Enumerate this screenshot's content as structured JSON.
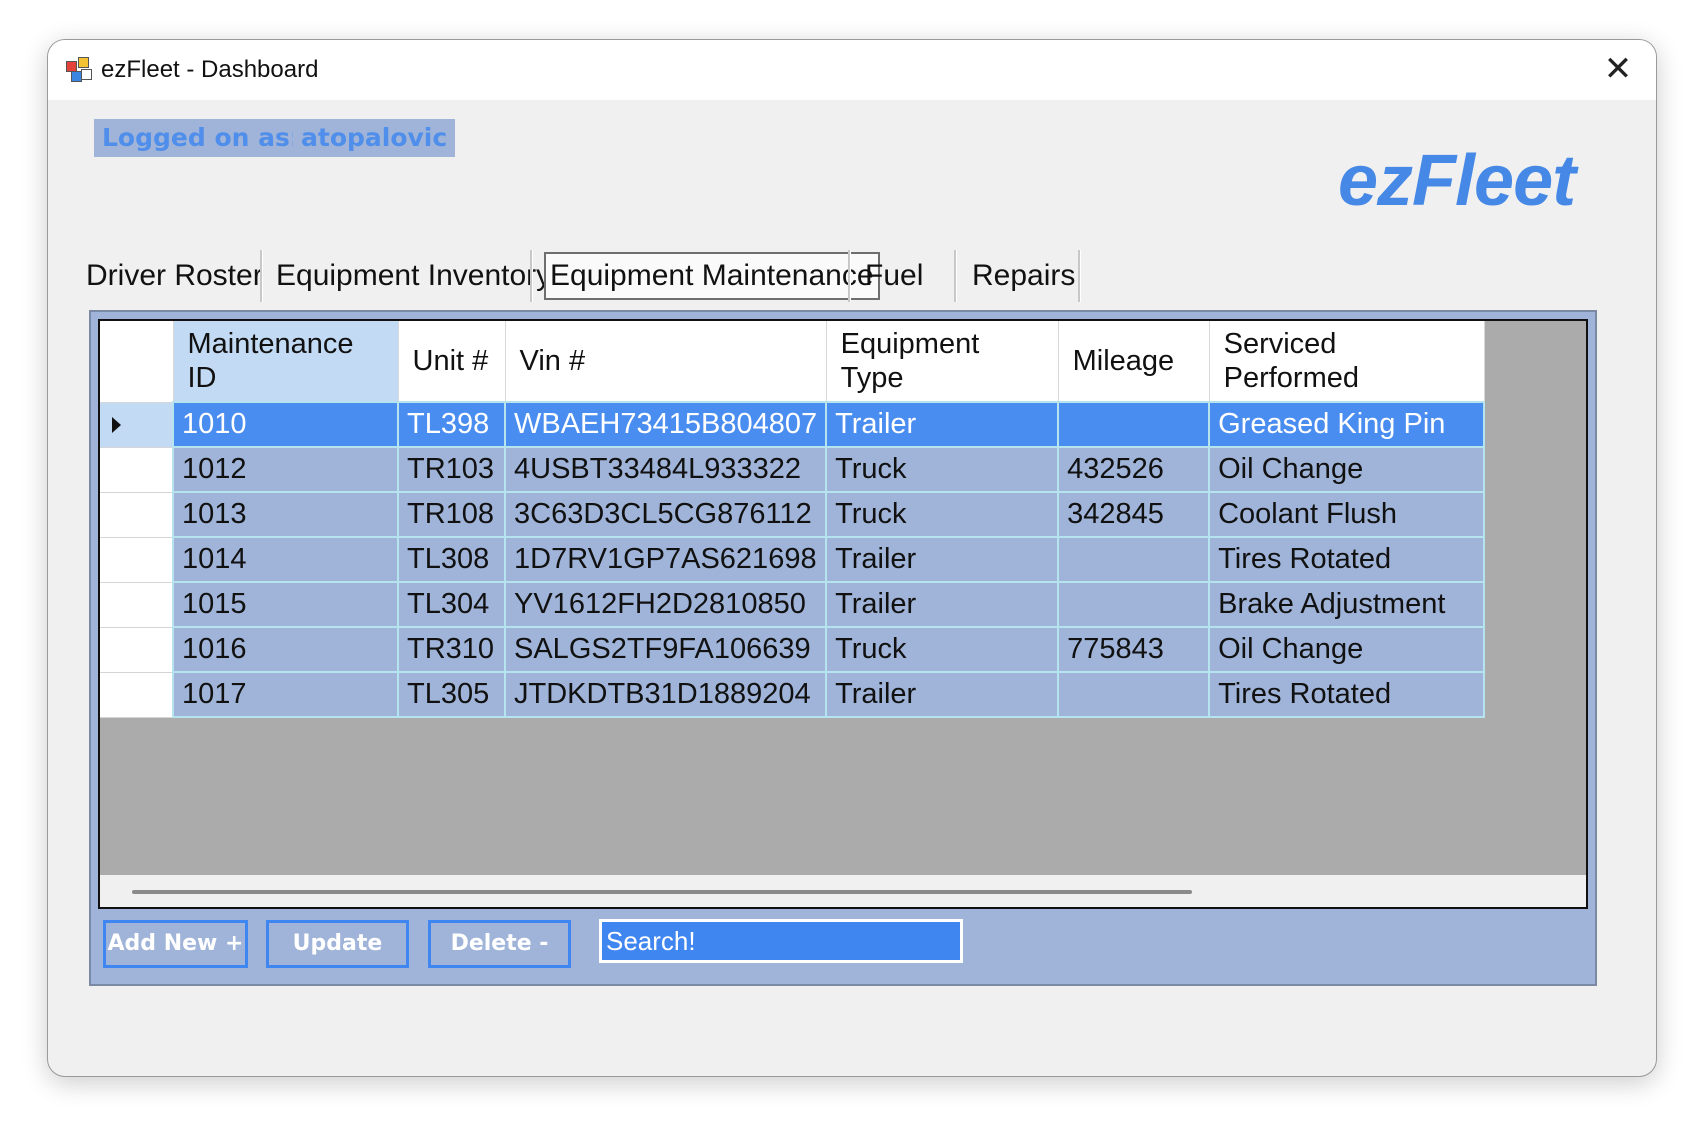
{
  "window": {
    "title": "ezFleet - Dashboard"
  },
  "user": {
    "logged_on_label": "Logged on as:",
    "username": "atopalovic"
  },
  "brand": "ezFleet",
  "tabs": [
    {
      "label": "Driver Roster",
      "active": false
    },
    {
      "label": "Equipment Inventory",
      "active": false
    },
    {
      "label": "Equipment Maintenance",
      "active": true
    },
    {
      "label": "Fuel",
      "active": false
    },
    {
      "label": "Repairs",
      "active": false
    }
  ],
  "grid": {
    "columns": [
      "Maintenance ID",
      "Unit #",
      "Vin #",
      "Equipment Type",
      "Mileage",
      "Serviced Performed"
    ],
    "rows": [
      {
        "id": "1010",
        "unit": "TL398",
        "vin": "WBAEH73415B804807",
        "type": "Trailer",
        "mileage": "",
        "service": "Greased King Pin",
        "selected": true
      },
      {
        "id": "1012",
        "unit": "TR103",
        "vin": "4USBT33484L933322",
        "type": "Truck",
        "mileage": "432526",
        "service": "Oil Change"
      },
      {
        "id": "1013",
        "unit": "TR108",
        "vin": "3C63D3CL5CG876112",
        "type": "Truck",
        "mileage": "342845",
        "service": "Coolant Flush"
      },
      {
        "id": "1014",
        "unit": "TL308",
        "vin": "1D7RV1GP7AS621698",
        "type": "Trailer",
        "mileage": "",
        "service": "Tires Rotated"
      },
      {
        "id": "1015",
        "unit": "TL304",
        "vin": "YV1612FH2D2810850",
        "type": "Trailer",
        "mileage": "",
        "service": "Brake Adjustment"
      },
      {
        "id": "1016",
        "unit": "TR310",
        "vin": "SALGS2TF9FA106639",
        "type": "Truck",
        "mileage": "775843",
        "service": "Oil Change"
      },
      {
        "id": "1017",
        "unit": "TL305",
        "vin": "JTDKDTB31D1889204",
        "type": "Trailer",
        "mileage": "",
        "service": "Tires Rotated"
      }
    ]
  },
  "actions": {
    "add": "Add New +",
    "update": "Update",
    "delete": "Delete -"
  },
  "search": {
    "placeholder": "Search!"
  },
  "colors": {
    "panel": "#9fb4d8",
    "accent": "#4a8df0",
    "brand": "#4588e6",
    "label_bg": "#9fb4d8",
    "label_text": "#4f8eea"
  }
}
